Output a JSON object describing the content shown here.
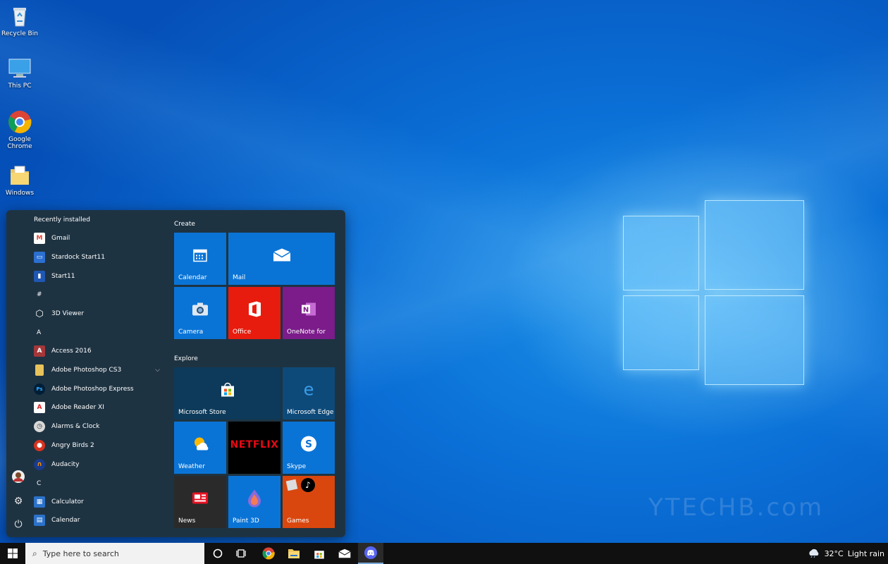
{
  "desktop": {
    "icons": [
      {
        "label": "Recycle Bin",
        "icon": "recycle-bin-icon"
      },
      {
        "label": "This PC",
        "icon": "computer-icon"
      },
      {
        "label": "Google Chrome",
        "icon": "chrome-icon"
      },
      {
        "label": "Windows",
        "icon": "folder-icon"
      }
    ],
    "watermark": "YTECHB.com"
  },
  "start_menu": {
    "recent_header": "Recently installed",
    "apps": [
      {
        "label": "Gmail",
        "icon": "gmail-icon",
        "color": "#ffffff"
      },
      {
        "label": "Stardock Start11",
        "icon": "start11-icon",
        "color": "#2b6fd1"
      },
      {
        "label": "Start11",
        "icon": "start11-icon",
        "color": "#1f57b3"
      }
    ],
    "letters": [
      "#",
      "A",
      "C"
    ],
    "app_3d_viewer": "3D Viewer",
    "apps_a": [
      {
        "label": "Access 2016",
        "icon": "access-icon",
        "color": "#a4373a"
      },
      {
        "label": "Adobe Photoshop CS3",
        "icon": "folder-icon",
        "color": "#e8c25a"
      },
      {
        "label": "Adobe Photoshop Express",
        "icon": "photoshop-icon",
        "color": "#001e36"
      },
      {
        "label": "Adobe Reader XI",
        "icon": "reader-icon",
        "color": "#ffffff"
      },
      {
        "label": "Alarms & Clock",
        "icon": "clock-icon",
        "color": "#d9d9d9"
      },
      {
        "label": "Angry Birds 2",
        "icon": "angry-birds-icon",
        "color": "#d8331f"
      },
      {
        "label": "Audacity",
        "icon": "audacity-icon",
        "color": "#1a3b8c"
      }
    ],
    "apps_c": [
      {
        "label": "Calculator",
        "icon": "calculator-icon",
        "color": "#2b72c9"
      },
      {
        "label": "Calendar",
        "icon": "calendar-icon",
        "color": "#2b72c9"
      }
    ],
    "groups": {
      "create": "Create",
      "explore": "Explore"
    },
    "tiles": {
      "calendar": {
        "label": "Calendar",
        "color": "#0a74d6"
      },
      "mail": {
        "label": "Mail",
        "color": "#0a74d6"
      },
      "camera": {
        "label": "Camera",
        "color": "#0a74d6"
      },
      "office": {
        "label": "Office",
        "color": "#e81c0e"
      },
      "onenote": {
        "label": "OneNote for",
        "color": "#7b1c8a"
      },
      "store": {
        "label": "Microsoft Store",
        "color": "#0d3a5a"
      },
      "edge": {
        "label": "Microsoft Edge",
        "color": "#0d4a7a"
      },
      "weather": {
        "label": "Weather",
        "color": "#0a74d6"
      },
      "netflix": {
        "label": "",
        "color": "#000000",
        "logo": "NETFLIX"
      },
      "skype": {
        "label": "Skype",
        "color": "#0a74d6"
      },
      "news": {
        "label": "News",
        "color": "#2a2a2a"
      },
      "paint3d": {
        "label": "Paint 3D",
        "color": "#0a74d6"
      },
      "games": {
        "label": "Games",
        "color": "#d9470f"
      }
    }
  },
  "taskbar": {
    "search_placeholder": "Type here to search",
    "temperature": "32°C",
    "weather": "Light rain"
  }
}
